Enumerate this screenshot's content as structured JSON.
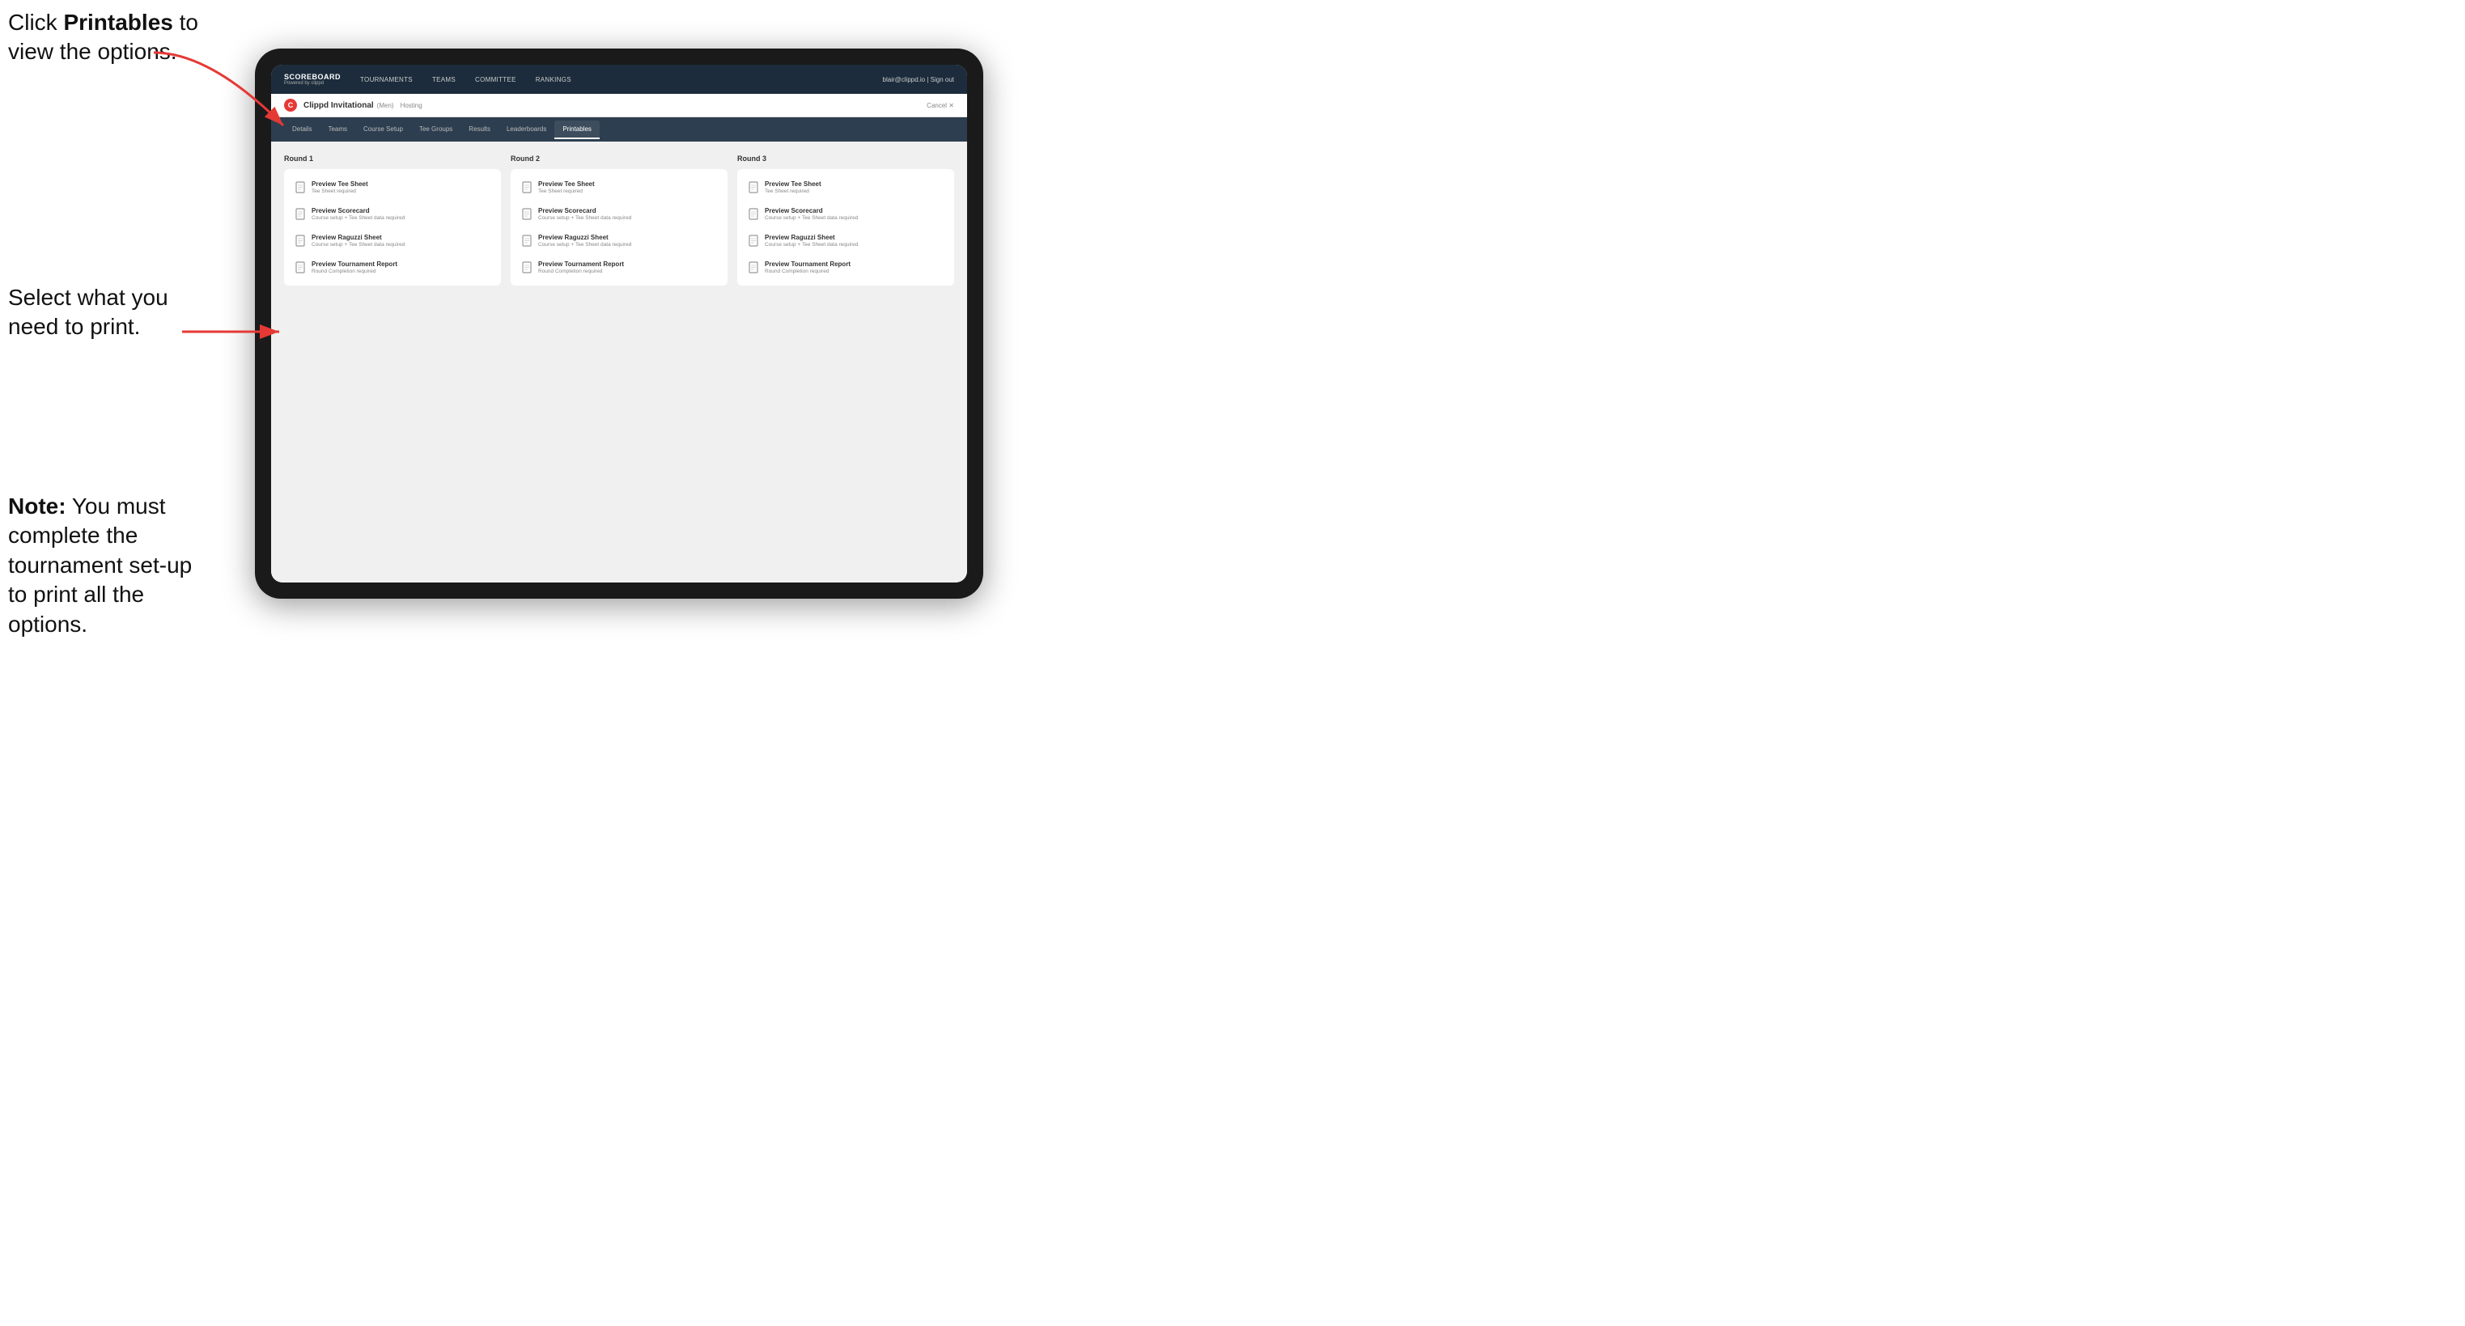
{
  "instructions": {
    "top_line1": "Click ",
    "top_bold": "Printables",
    "top_line2": " to",
    "top_line3": "view the options.",
    "middle_line1": "Select what you",
    "middle_line2": "need to print.",
    "bottom_bold": "Note:",
    "bottom_text": " You must complete the tournament set-up to print all the options."
  },
  "nav": {
    "brand_title": "SCOREBOARD",
    "brand_sub": "Powered by clippd",
    "links": [
      "TOURNAMENTS",
      "TEAMS",
      "COMMITTEE",
      "RANKINGS"
    ],
    "user": "blair@clippd.io  |  Sign out"
  },
  "tournament": {
    "logo_letter": "C",
    "name": "Clippd Invitational",
    "category": "(Men)",
    "status": "Hosting",
    "cancel": "Cancel ✕"
  },
  "sub_tabs": [
    "Details",
    "Teams",
    "Course Setup",
    "Tee Groups",
    "Results",
    "Leaderboards",
    "Printables"
  ],
  "active_tab": "Printables",
  "rounds": [
    {
      "title": "Round 1",
      "items": [
        {
          "title": "Preview Tee Sheet",
          "subtitle": "Tee Sheet required"
        },
        {
          "title": "Preview Scorecard",
          "subtitle": "Course setup + Tee Sheet data required"
        },
        {
          "title": "Preview Raguzzi Sheet",
          "subtitle": "Course setup + Tee Sheet data required"
        },
        {
          "title": "Preview Tournament Report",
          "subtitle": "Round Completion required"
        }
      ]
    },
    {
      "title": "Round 2",
      "items": [
        {
          "title": "Preview Tee Sheet",
          "subtitle": "Tee Sheet required"
        },
        {
          "title": "Preview Scorecard",
          "subtitle": "Course setup + Tee Sheet data required"
        },
        {
          "title": "Preview Raguzzi Sheet",
          "subtitle": "Course setup + Tee Sheet data required"
        },
        {
          "title": "Preview Tournament Report",
          "subtitle": "Round Completion required"
        }
      ]
    },
    {
      "title": "Round 3",
      "items": [
        {
          "title": "Preview Tee Sheet",
          "subtitle": "Tee Sheet required"
        },
        {
          "title": "Preview Scorecard",
          "subtitle": "Course setup + Tee Sheet data required"
        },
        {
          "title": "Preview Raguzzi Sheet",
          "subtitle": "Course setup + Tee Sheet data required"
        },
        {
          "title": "Preview Tournament Report",
          "subtitle": "Round Completion required"
        }
      ]
    }
  ]
}
